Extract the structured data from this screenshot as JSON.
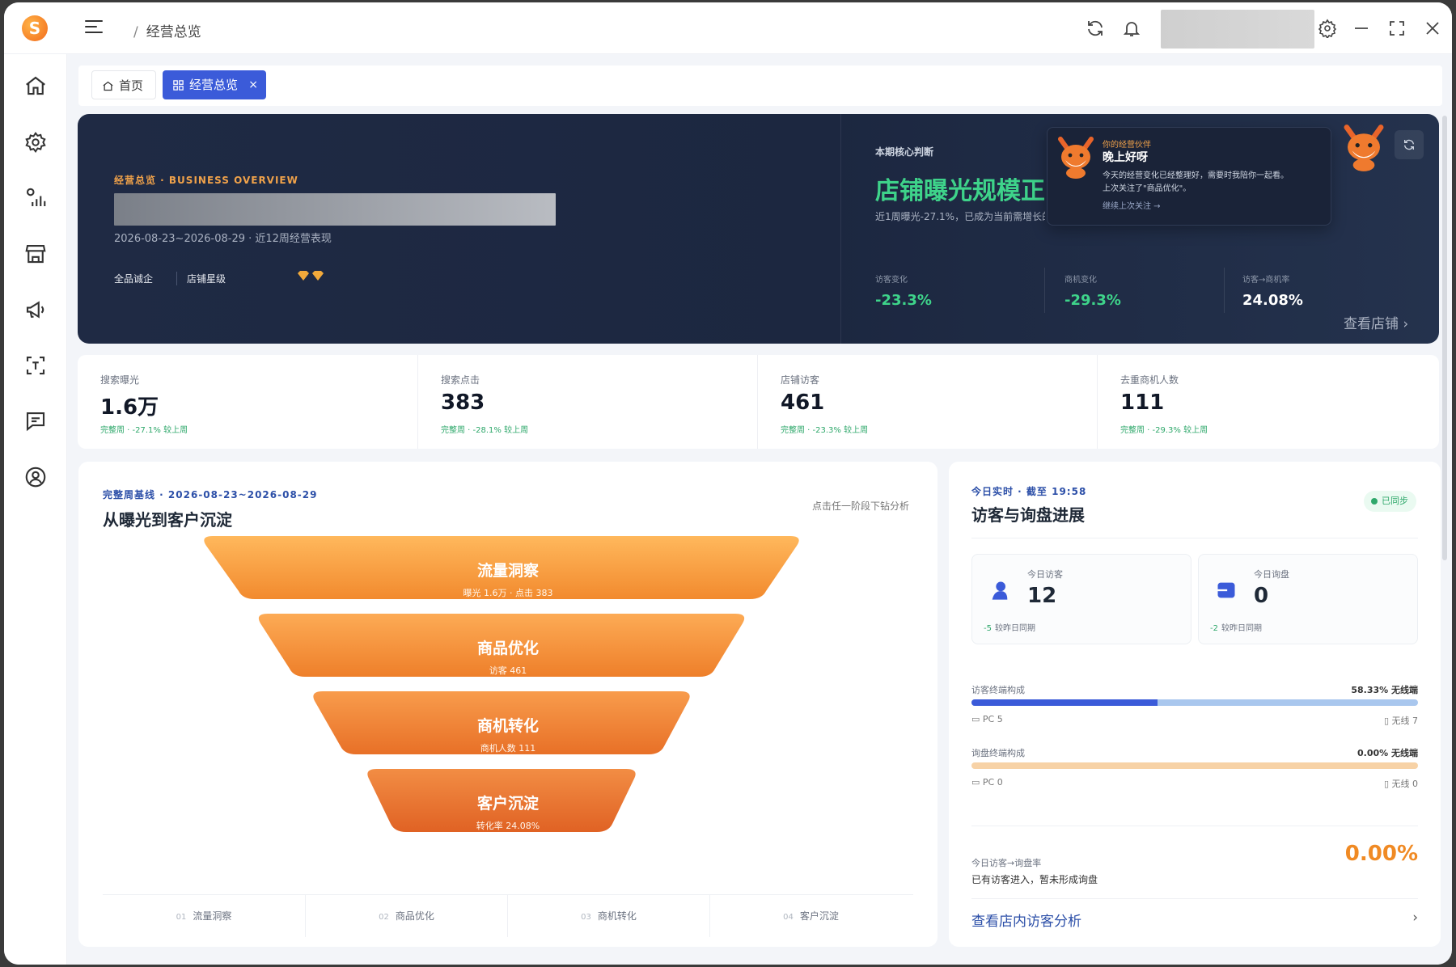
{
  "titlebar": {
    "logo": "S",
    "breadcrumb_sep": "/",
    "breadcrumb": "经营总览"
  },
  "tabs": [
    {
      "label": "首页"
    },
    {
      "label": "经营总览",
      "close": "×"
    }
  ],
  "hero": {
    "eyebrow": "经营总览 · BUSINESS OVERVIEW",
    "date_range": "2026-08-23~2026-08-29 · 近12周经营表现",
    "tag_level": "全品诚企",
    "tag_rating": "店铺星级",
    "core_label": "本期核心判断",
    "core_headline": "店铺曝光规模正在下降",
    "core_desc": "近1周曝光-27.1%，已成为当前需增长的首要问题",
    "metrics": [
      {
        "label": "访客变化",
        "value": "-23.3%",
        "color": "#3ed38a"
      },
      {
        "label": "商机变化",
        "value": "-29.3%",
        "color": "#3ed38a"
      },
      {
        "label": "访客→商机率",
        "value": "24.08%",
        "color": "#ffffff"
      }
    ],
    "view_store": "查看店铺",
    "bubble": {
      "small": "你的经营伙伴",
      "title": "晚上好呀",
      "line1": "今天的经营变化已经整理好，需要时我陪你一起看。",
      "line2": "上次关注了\"商品优化\"。",
      "link": "继续上次关注 →"
    }
  },
  "kpis": [
    {
      "label": "搜索曝光",
      "value": "1.6万",
      "sub": "完整周 · -27.1% 较上周"
    },
    {
      "label": "搜索点击",
      "value": "383",
      "sub": "完整周 · -28.1% 较上周"
    },
    {
      "label": "店铺访客",
      "value": "461",
      "sub": "完整周 · -23.3% 较上周"
    },
    {
      "label": "去重商机人数",
      "value": "111",
      "sub": "完整周 · -29.3% 较上周"
    }
  ],
  "funnel": {
    "eyebrow": "完整周基线 · 2026-08-23~2026-08-29",
    "title": "从曝光到客户沉淀",
    "hint": "点击任一阶段下钻分析",
    "stages": [
      {
        "title": "流量洞察",
        "sub": "曝光 1.6万 · 点击 383"
      },
      {
        "title": "商品优化",
        "sub": "访客 461"
      },
      {
        "title": "商机转化",
        "sub": "商机人数 111"
      },
      {
        "title": "客户沉淀",
        "sub": "转化率 24.08%"
      }
    ],
    "steps": [
      {
        "num": "01",
        "label": "流量洞察"
      },
      {
        "num": "02",
        "label": "商品优化"
      },
      {
        "num": "03",
        "label": "商机转化"
      },
      {
        "num": "04",
        "label": "客户沉淀"
      }
    ]
  },
  "visits": {
    "eyebrow": "今日实时 · 截至 19:58",
    "title": "访客与询盘进展",
    "sync": "已同步",
    "today_visitors": {
      "label": "今日访客",
      "value": "12",
      "delta": "-5",
      "delta_note": "较昨日同期"
    },
    "today_inquiries": {
      "label": "今日询盘",
      "value": "0",
      "delta": "-2",
      "delta_note": "较昨日同期"
    },
    "visitor_device": {
      "label": "访客终端构成",
      "right": "58.33% 无线端",
      "pc": "PC 5",
      "mobile": "无线 7",
      "pc_fraction": 0.4167,
      "pc_color": "#3b5bd9",
      "mobile_color": "#a9c7ee"
    },
    "inquiry_device": {
      "label": "询盘终端构成",
      "right": "0.00% 无线端",
      "pc": "PC 0",
      "mobile": "无线 0",
      "color": "#f7d2a6"
    },
    "rate_label": "今日访客→询盘率",
    "rate_desc": "已有访客进入，暂未形成询盘",
    "rate_value": "0.00%",
    "link": "查看店内访客分析",
    "chevron": "›"
  }
}
